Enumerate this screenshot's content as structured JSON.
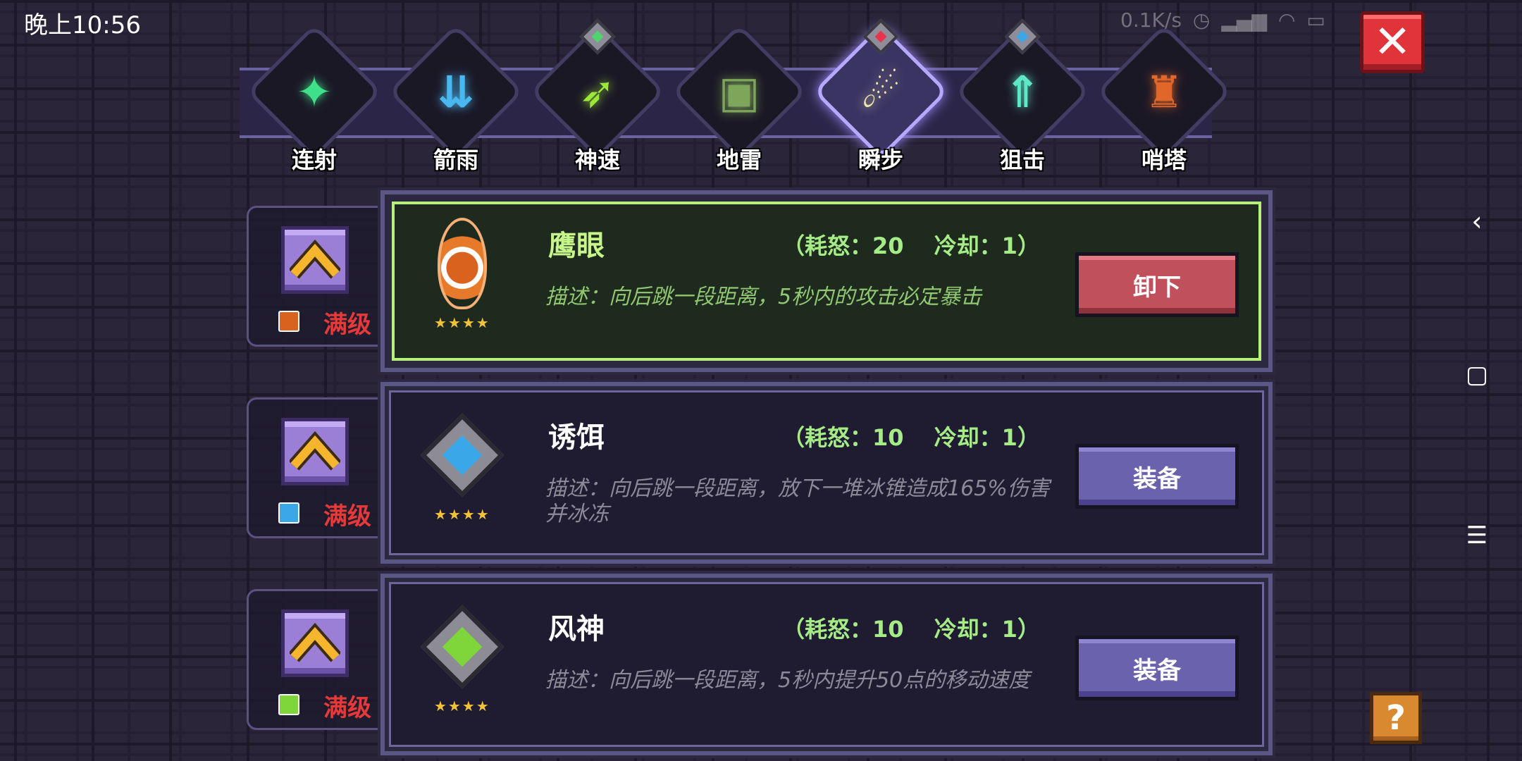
{
  "status_bar": {
    "time": "晚上10:56",
    "network_speed": "0.1K/s"
  },
  "close_label": "✕",
  "tabs": [
    {
      "label": "连射",
      "glyph": "✦",
      "color": "#3fe08a",
      "active": false,
      "gem": null
    },
    {
      "label": "箭雨",
      "glyph": "⇊",
      "color": "#4ab8f0",
      "active": false,
      "gem": null
    },
    {
      "label": "神速",
      "glyph": "➶",
      "color": "#9be83a",
      "active": false,
      "gem": "green"
    },
    {
      "label": "地雷",
      "glyph": "▣",
      "color": "#7ea65a",
      "active": false,
      "gem": null
    },
    {
      "label": "瞬步",
      "glyph": "☄",
      "color": "#f0e6a8",
      "active": true,
      "gem": "red"
    },
    {
      "label": "狙击",
      "glyph": "⇑",
      "color": "#5ee8c8",
      "active": false,
      "gem": "blue"
    },
    {
      "label": "哨塔",
      "glyph": "♜",
      "color": "#e0662a",
      "active": false,
      "gem": null
    }
  ],
  "skills": [
    {
      "name": "鹰眼",
      "cost": "（耗怒：20　 冷却：1）",
      "description": "描述：向后跳一段距离，5秒内的攻击必定暴击",
      "stars": "★★★★",
      "level": "满级",
      "button": "卸下",
      "equipped": true,
      "core_color": "#d9621e"
    },
    {
      "name": "诱饵",
      "cost": "（耗怒：10　 冷却：1）",
      "description": "描述：向后跳一段距离，放下一堆冰锥造成165%伤害并冰冻",
      "stars": "★★★★",
      "level": "满级",
      "button": "装备",
      "equipped": false,
      "core_color": "#3aa8e8"
    },
    {
      "name": "风神",
      "cost": "（耗怒：10　 冷却：1）",
      "description": "描述：向后跳一段距离，5秒内提升50点的移动速度",
      "stars": "★★★★",
      "level": "满级",
      "button": "装备",
      "equipped": false,
      "core_color": "#7ed63a"
    }
  ],
  "help_label": "?",
  "nav": {
    "back": "‹",
    "home": "▢",
    "menu": "☰"
  }
}
